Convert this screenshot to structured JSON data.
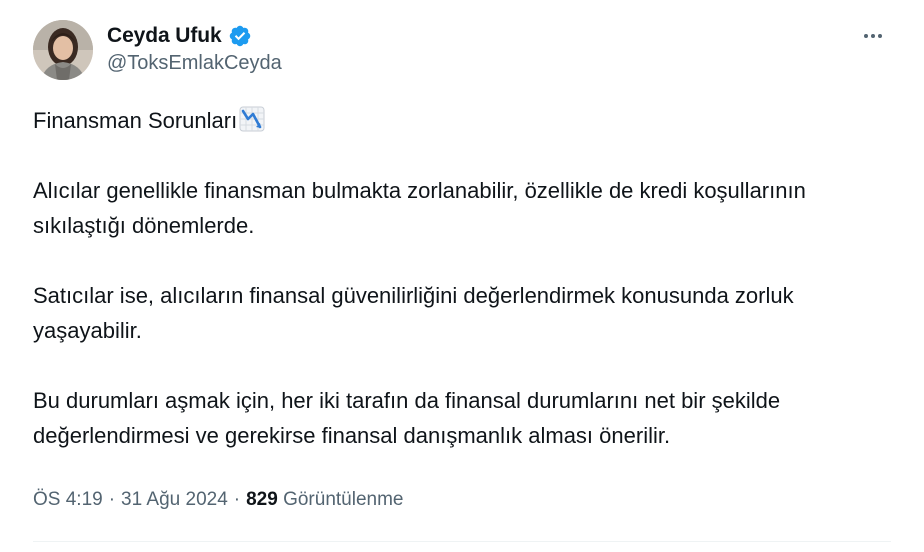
{
  "author": {
    "display_name": "Ceyda Ufuk",
    "handle": "@ToksEmlakCeyda",
    "verified": true,
    "verified_color": "#1d9bf0"
  },
  "tweet": {
    "title": "Finansman Sorunları",
    "title_emoji_icon": "chart-decreasing-icon",
    "paragraphs": [
      "Alıcılar genellikle finansman bulmakta zorlanabilir, özellikle de kredi koşullarının sıkılaştığı dönemlerde.",
      "Satıcılar ise, alıcıların finansal güvenilirliğini değerlendirmek konusunda zorluk yaşayabilir.",
      "Bu durumları aşmak için, her iki tarafın da finansal durumlarını net bir şekilde değerlendirmesi ve gerekirse finansal danışmanlık alması önerilir."
    ]
  },
  "meta": {
    "time": "ÖS 4:19",
    "separator": "·",
    "date": "31 Ağu 2024",
    "views_count": "829",
    "views_label": "Görüntülenme"
  },
  "icons": {
    "more": "more-horizontal-icon",
    "verified": "verified-badge-icon"
  }
}
